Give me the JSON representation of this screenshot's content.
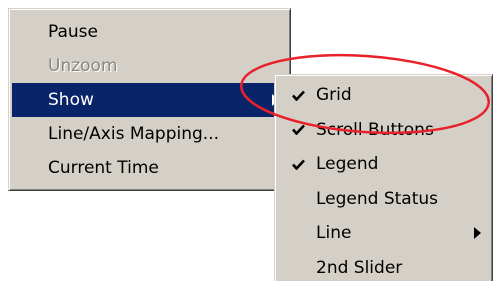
{
  "main_menu": {
    "items": [
      {
        "label": "Pause"
      },
      {
        "label": "Unzoom"
      },
      {
        "label": "Show"
      },
      {
        "label": "Line/Axis Mapping..."
      },
      {
        "label": "Current Time"
      }
    ]
  },
  "sub_menu": {
    "items": [
      {
        "label": "Grid",
        "checked": true
      },
      {
        "label": "Scroll Buttons",
        "checked": true
      },
      {
        "label": "Legend",
        "checked": true
      },
      {
        "label": "Legend Status",
        "checked": false
      },
      {
        "label": "Line",
        "checked": false
      },
      {
        "label": "2nd Slider",
        "checked": false
      }
    ]
  },
  "icons": {
    "check": "check-icon",
    "submenu_arrow": "chevron-right-icon"
  },
  "colors": {
    "menu_bg": "#d4d0c8",
    "highlight_bg": "#0a246a",
    "annotation_ellipse": "#e8212b",
    "disabled_text": "#8a8780"
  }
}
